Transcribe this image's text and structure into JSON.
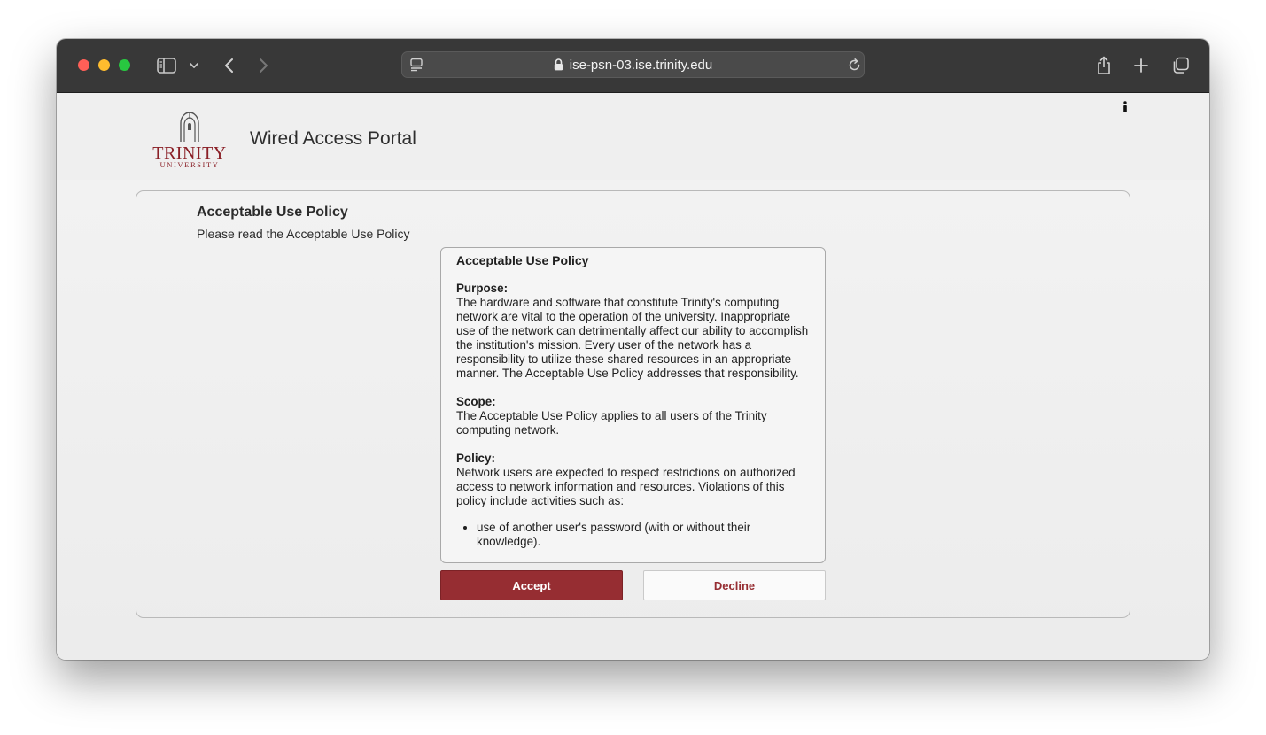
{
  "browser": {
    "url": "ise-psn-03.ise.trinity.edu"
  },
  "header": {
    "logo_word": "TRINITY",
    "logo_sub": "UNIVERSITY",
    "portal_title": "Wired Access Portal"
  },
  "main": {
    "heading": "Acceptable Use Policy",
    "subheading": "Please read the Acceptable Use Policy",
    "policy": {
      "title": "Acceptable Use Policy",
      "purpose_heading": "Purpose:",
      "purpose_text": "The hardware and software that constitute Trinity's computing network are vital to the operation of the university. Inappropriate use of the network can detrimentally affect our ability to accomplish the institution's mission. Every user of the network has a responsibility to utilize these shared resources in an appropriate manner. The Acceptable Use Policy addresses that responsibility.",
      "scope_heading": "Scope:",
      "scope_text": "The Acceptable Use Policy applies to all users of the Trinity computing network.",
      "policy_heading": "Policy:",
      "policy_text": "Network users are expected to respect restrictions on authorized access to network information and resources. Violations of this policy include activities such as:",
      "bullets": [
        "use of another user's password (with or without their knowledge)."
      ]
    },
    "accept_label": "Accept",
    "decline_label": "Decline"
  },
  "colors": {
    "brand": "#962d32",
    "titlebar": "#383838"
  }
}
